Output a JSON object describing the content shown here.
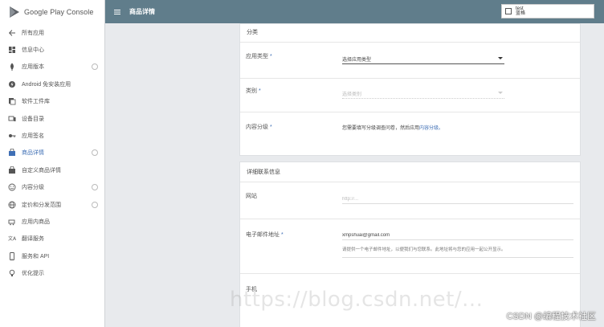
{
  "app": {
    "brand": "Google Play Console",
    "page_title": "商品详情"
  },
  "account": {
    "line1": "test",
    "line2": "蓝格"
  },
  "sidebar": {
    "items": [
      {
        "label": "所有应用",
        "icon": "arrow-left-icon",
        "help": false,
        "active": false
      },
      {
        "label": "信息中心",
        "icon": "dashboard-icon",
        "help": false,
        "active": false
      },
      {
        "label": "应用版本",
        "icon": "rocket-icon",
        "help": true,
        "active": false
      },
      {
        "label": "Android 免安装应用",
        "icon": "instant-app-icon",
        "help": false,
        "active": false
      },
      {
        "label": "软件工件库",
        "icon": "library-icon",
        "help": false,
        "active": false
      },
      {
        "label": "设备目录",
        "icon": "devices-icon",
        "help": false,
        "active": false
      },
      {
        "label": "应用签名",
        "icon": "key-icon",
        "help": false,
        "active": false
      },
      {
        "label": "商品详情",
        "icon": "store-icon",
        "help": true,
        "active": true
      },
      {
        "label": "自定义商品详情",
        "icon": "store-custom-icon",
        "help": false,
        "active": false
      },
      {
        "label": "内容分级",
        "icon": "rating-icon",
        "help": true,
        "active": false
      },
      {
        "label": "定价和分发范围",
        "icon": "globe-icon",
        "help": true,
        "active": false
      },
      {
        "label": "应用内商品",
        "icon": "cart-icon",
        "help": false,
        "active": false
      },
      {
        "label": "翻译服务",
        "icon": "translate-icon",
        "help": false,
        "active": false
      },
      {
        "label": "服务和 API",
        "icon": "phone-icon",
        "help": false,
        "active": false
      },
      {
        "label": "优化提示",
        "icon": "lightbulb-icon",
        "help": false,
        "active": false
      }
    ]
  },
  "categorization": {
    "title": "分类",
    "app_type": {
      "label": "应用类型",
      "required": "*",
      "value": "选择应用类型"
    },
    "category": {
      "label": "类别",
      "required": "*",
      "value": "选择类别"
    },
    "content_rating": {
      "label": "内容分级",
      "required": "*",
      "text": "您需要填写分级调查问卷，然后应用",
      "link": "内容分级。"
    }
  },
  "contact": {
    "title": "详细联系信息",
    "website": {
      "label": "网站",
      "placeholder": "http://..."
    },
    "email": {
      "label": "电子邮件地址",
      "required": "*",
      "value": "xmpshuai@gmail.com",
      "hint": "请提供一个电子邮件地址，以便我们与您联系。此地址将与您的应用一起公开显示。"
    },
    "phone": {
      "label": "手机"
    }
  },
  "overlay": {
    "watermark": "https://blog.csdn.net/...",
    "credit": "CSDN @编程技术社区"
  }
}
